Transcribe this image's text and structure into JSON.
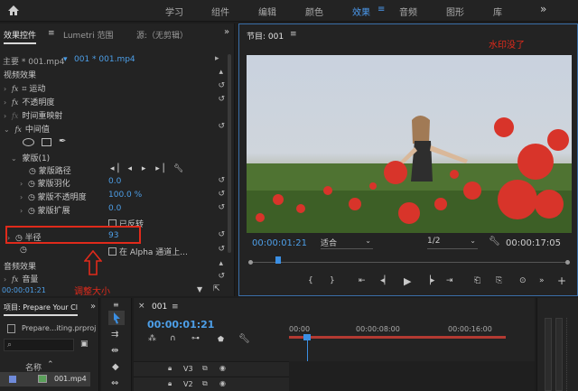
{
  "workspaces": [
    "学习",
    "组件",
    "编辑",
    "颜色",
    "效果",
    "音频",
    "图形",
    "库"
  ],
  "active_workspace": "效果",
  "effect_controls": {
    "tab_active": "效果控件",
    "tab_lumetri": "Lumetri 范围",
    "tab_source": "源:（无剪辑）",
    "master_label": "主要 * 001.mp4",
    "clip_label": "001 * 001.mp4",
    "video_effects": "视频效果",
    "motion": "运动",
    "opacity": "不透明度",
    "time_remap": "时间重映射",
    "median": "中间值",
    "mask": "蒙版(1)",
    "mask_path": "蒙版路径",
    "mask_feather": "蒙版羽化",
    "mask_feather_val": "0.0",
    "mask_opacity": "蒙版不透明度",
    "mask_opacity_val": "100.0 %",
    "mask_expand": "蒙版扩展",
    "mask_expand_val": "0.0",
    "inverted": "已反转",
    "radius": "半径",
    "radius_val": "93",
    "alpha": "在 Alpha 通道上...",
    "audio_effects": "音频效果",
    "volume": "音量",
    "timecode": "00:00:01:21",
    "annotation": "调整大小"
  },
  "program": {
    "title": "节目: 001",
    "timecode": "00:00:01:21",
    "fit": "适合",
    "resolution": "1/2",
    "duration": "00:00:17:05",
    "annotation": "水印没了"
  },
  "project": {
    "tab": "项目: Prepare Your Cl",
    "file": "Prepare...iting.prproj",
    "name_col": "名称",
    "clip": "001.mp4"
  },
  "timeline": {
    "tab": "001",
    "timecode": "00:00:01:21",
    "ruler": [
      "00:00",
      "00:00:08:00",
      "00:00:16:00"
    ],
    "tracks": [
      "V3",
      "V2"
    ]
  },
  "colors": {
    "accent": "#4c9bf0",
    "annotation_red": "#e02a1b",
    "playhead": "#3b8fe3"
  }
}
